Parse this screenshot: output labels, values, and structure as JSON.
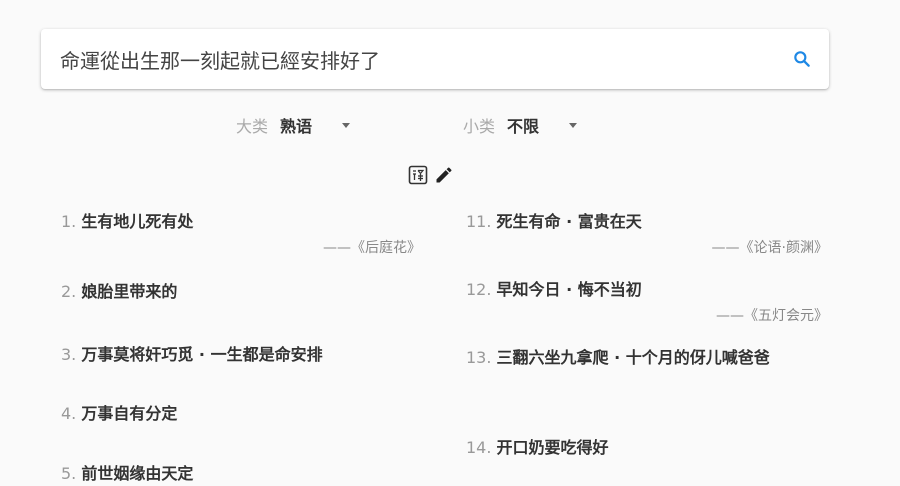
{
  "search": {
    "query": "命運從出生那一刻起就已經安排好了"
  },
  "filters": {
    "category": {
      "label": "大类",
      "value": "熟语"
    },
    "subcategory": {
      "label": "小类",
      "value": "不限"
    }
  },
  "tools": {
    "translate_icon": "translate-icon",
    "edit_icon": "pencil-icon"
  },
  "results_left": [
    {
      "num": "1.",
      "text": "生有地儿死有处",
      "source": "——《后庭花》"
    },
    {
      "num": "2.",
      "text": "娘胎里带来的",
      "source": ""
    },
    {
      "num": "3.",
      "text": "万事莫将奸巧觅 · 一生都是命安排",
      "source": ""
    },
    {
      "num": "4.",
      "text": "万事自有分定",
      "source": ""
    },
    {
      "num": "5.",
      "text": "前世姻缘由天定",
      "source": ""
    }
  ],
  "results_right": [
    {
      "num": "11.",
      "text": "死生有命 · 富贵在天",
      "source": "——《论语·颜渊》"
    },
    {
      "num": "12.",
      "text": "早知今日 · 悔不当初",
      "source": "——《五灯会元》"
    },
    {
      "num": "13.",
      "text": "三翻六坐九拿爬 · 十个月的伢儿喊爸爸",
      "source": ""
    },
    {
      "num": "14.",
      "text": "开口奶要吃得好",
      "source": ""
    }
  ],
  "colors": {
    "accent": "#1e88e5"
  }
}
